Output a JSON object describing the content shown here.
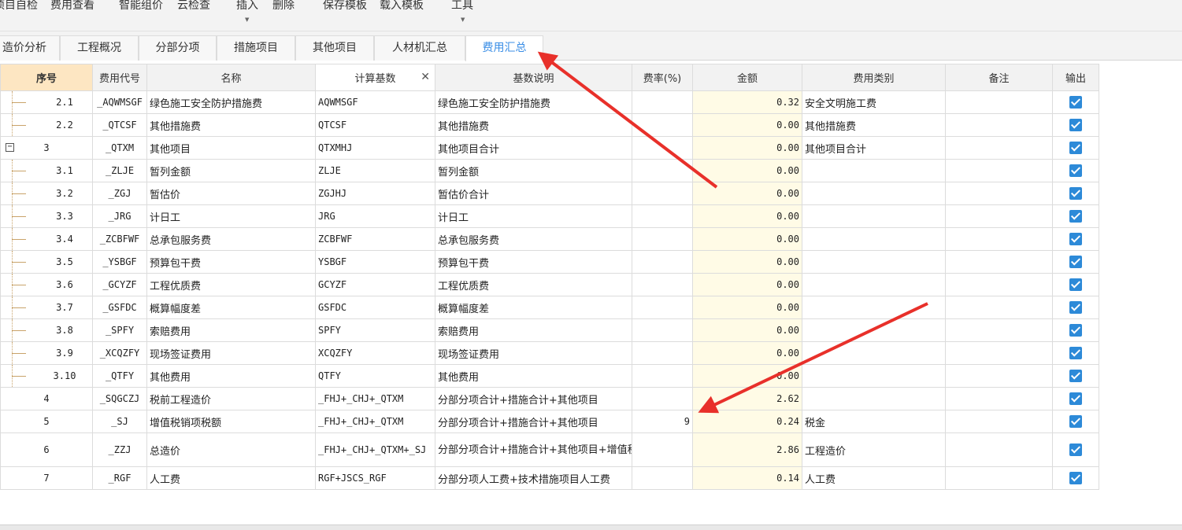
{
  "toolbar": {
    "items": [
      "项目自检",
      "费用查看",
      "智能组价",
      "云检查",
      "插入",
      "删除",
      "保存模板",
      "载入模板",
      "工具"
    ]
  },
  "tabs": [
    "造价分析",
    "工程概况",
    "分部分项",
    "措施项目",
    "其他项目",
    "人材机汇总",
    "费用汇总"
  ],
  "active_tab": "费用汇总",
  "table": {
    "headers": [
      "序号",
      "费用代号",
      "名称",
      "计算基数",
      "基数说明",
      "费率(%)",
      "金额",
      "费用类别",
      "备注",
      "输出"
    ],
    "rows": [
      {
        "seq": "2.1",
        "code": "_AQWMSGF",
        "name": "绿色施工安全防护措施费",
        "base": "AQWMSGF",
        "desc": "绿色施工安全防护措施费",
        "rate": "",
        "amount": "0.32",
        "category": "安全文明施工费",
        "note": ""
      },
      {
        "seq": "2.2",
        "code": "_QTCSF",
        "name": "其他措施费",
        "base": "QTCSF",
        "desc": "其他措施费",
        "rate": "",
        "amount": "0.00",
        "category": "其他措施费",
        "note": ""
      },
      {
        "seq": "3",
        "code": "_QTXM",
        "name": "其他项目",
        "base": "QTXMHJ",
        "desc": "其他项目合计",
        "rate": "",
        "amount": "0.00",
        "category": "其他项目合计",
        "note": ""
      },
      {
        "seq": "3.1",
        "code": "_ZLJE",
        "name": "暂列金额",
        "base": "ZLJE",
        "desc": "暂列金额",
        "rate": "",
        "amount": "0.00",
        "category": "",
        "note": ""
      },
      {
        "seq": "3.2",
        "code": "_ZGJ",
        "name": "暂估价",
        "base": "ZGJHJ",
        "desc": "暂估价合计",
        "rate": "",
        "amount": "0.00",
        "category": "",
        "note": ""
      },
      {
        "seq": "3.3",
        "code": "_JRG",
        "name": "计日工",
        "base": "JRG",
        "desc": "计日工",
        "rate": "",
        "amount": "0.00",
        "category": "",
        "note": ""
      },
      {
        "seq": "3.4",
        "code": "_ZCBFWF",
        "name": "总承包服务费",
        "base": "ZCBFWF",
        "desc": "总承包服务费",
        "rate": "",
        "amount": "0.00",
        "category": "",
        "note": ""
      },
      {
        "seq": "3.5",
        "code": "_YSBGF",
        "name": "预算包干费",
        "base": "YSBGF",
        "desc": "预算包干费",
        "rate": "",
        "amount": "0.00",
        "category": "",
        "note": ""
      },
      {
        "seq": "3.6",
        "code": "_GCYZF",
        "name": "工程优质费",
        "base": "GCYZF",
        "desc": "工程优质费",
        "rate": "",
        "amount": "0.00",
        "category": "",
        "note": ""
      },
      {
        "seq": "3.7",
        "code": "_GSFDC",
        "name": "概算幅度差",
        "base": "GSFDC",
        "desc": "概算幅度差",
        "rate": "",
        "amount": "0.00",
        "category": "",
        "note": ""
      },
      {
        "seq": "3.8",
        "code": "_SPFY",
        "name": "索赔费用",
        "base": "SPFY",
        "desc": "索赔费用",
        "rate": "",
        "amount": "0.00",
        "category": "",
        "note": ""
      },
      {
        "seq": "3.9",
        "code": "_XCQZFY",
        "name": "现场签证费用",
        "base": "XCQZFY",
        "desc": "现场签证费用",
        "rate": "",
        "amount": "0.00",
        "category": "",
        "note": ""
      },
      {
        "seq": "3.10",
        "code": "_QTFY",
        "name": "其他费用",
        "base": "QTFY",
        "desc": "其他费用",
        "rate": "",
        "amount": "0.00",
        "category": "",
        "note": ""
      },
      {
        "seq": "4",
        "code": "_SQGCZJ",
        "name": "税前工程造价",
        "base": "_FHJ+_CHJ+_QTXM",
        "desc": "分部分项合计+措施合计+其他项目",
        "rate": "",
        "amount": "2.62",
        "category": "",
        "note": ""
      },
      {
        "seq": "5",
        "code": "_SJ",
        "name": "增值税销项税额",
        "base": "_FHJ+_CHJ+_QTXM",
        "desc": "分部分项合计+措施合计+其他项目",
        "rate": "9",
        "amount": "0.24",
        "category": "税金",
        "note": ""
      },
      {
        "seq": "6",
        "code": "_ZZJ",
        "name": "总造价",
        "base": "_FHJ+_CHJ+_QTXM+_SJ",
        "desc": "分部分项合计+措施合计+其他项目+增值税销项税额",
        "rate": "",
        "amount": "2.86",
        "category": "工程造价",
        "note": ""
      },
      {
        "seq": "7",
        "code": "_RGF",
        "name": "人工费",
        "base": "RGF+JSCS_RGF",
        "desc": "分部分项人工费+技术措施项目人工费",
        "rate": "",
        "amount": "0.14",
        "category": "人工费",
        "note": ""
      }
    ]
  },
  "colors": {
    "accent": "#3a8ee6",
    "arrow": "#e8302a",
    "amount_bg": "#fffbe6",
    "seq_header_bg": "#fde6c2",
    "checkbox": "#2d8ad8"
  }
}
